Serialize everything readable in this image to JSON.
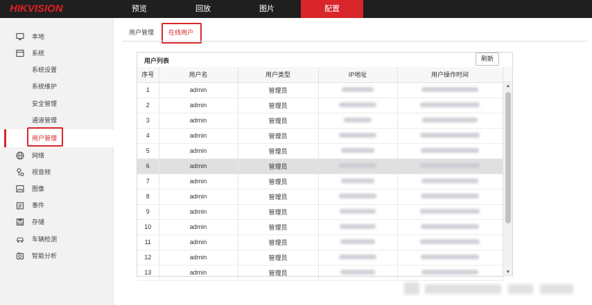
{
  "header": {
    "logo": "HIKVISION",
    "nav": [
      "预览",
      "回放",
      "图片",
      "配置"
    ],
    "active_nav": 3
  },
  "sidebar": {
    "items": [
      {
        "label": "本地",
        "icon": "monitor-icon",
        "level": 0
      },
      {
        "label": "系统",
        "icon": "system-icon",
        "level": 0
      },
      {
        "label": "系统设置",
        "level": 1
      },
      {
        "label": "系统维护",
        "level": 1
      },
      {
        "label": "安全管理",
        "level": 1
      },
      {
        "label": "通道管理",
        "level": 1
      },
      {
        "label": "用户管理",
        "level": 1,
        "active": true
      },
      {
        "label": "网络",
        "icon": "network-globe-icon",
        "level": 0
      },
      {
        "label": "视音频",
        "icon": "audio-video-icon",
        "level": 0
      },
      {
        "label": "图像",
        "icon": "image-icon",
        "level": 0
      },
      {
        "label": "事件",
        "icon": "event-calendar-icon",
        "level": 0
      },
      {
        "label": "存储",
        "icon": "storage-disk-icon",
        "level": 0
      },
      {
        "label": "车辆检测",
        "icon": "vehicle-detect-icon",
        "level": 0
      },
      {
        "label": "智能分析",
        "icon": "smart-analysis-icon",
        "level": 0
      }
    ]
  },
  "tabs": [
    "用户管理",
    "在线用户"
  ],
  "active_tab": 1,
  "panel": {
    "title": "用户列表",
    "refresh_label": "刷新",
    "columns": [
      "序号",
      "用户名",
      "用户类型",
      "IP地址",
      "用户操作时间"
    ],
    "rows": [
      {
        "no": "1",
        "user": "admin",
        "type": "管理员"
      },
      {
        "no": "2",
        "user": "admin",
        "type": "管理员"
      },
      {
        "no": "3",
        "user": "admin",
        "type": "管理员"
      },
      {
        "no": "4",
        "user": "admin",
        "type": "管理员"
      },
      {
        "no": "5",
        "user": "admin",
        "type": "管理员"
      },
      {
        "no": "6",
        "user": "admin",
        "type": "管理员",
        "highlight": true
      },
      {
        "no": "7",
        "user": "admin",
        "type": "管理员"
      },
      {
        "no": "8",
        "user": "admin",
        "type": "管理员"
      },
      {
        "no": "9",
        "user": "admin",
        "type": "管理员"
      },
      {
        "no": "10",
        "user": "admin",
        "type": "管理员"
      },
      {
        "no": "11",
        "user": "admin",
        "type": "管理员"
      },
      {
        "no": "12",
        "user": "admin",
        "type": "管理员"
      },
      {
        "no": "13",
        "user": "admin",
        "type": "管理员"
      }
    ]
  },
  "colors": {
    "accent": "#d8262a",
    "topbar": "#1f1f1f",
    "sidebar_bg": "#f2f2f2"
  }
}
